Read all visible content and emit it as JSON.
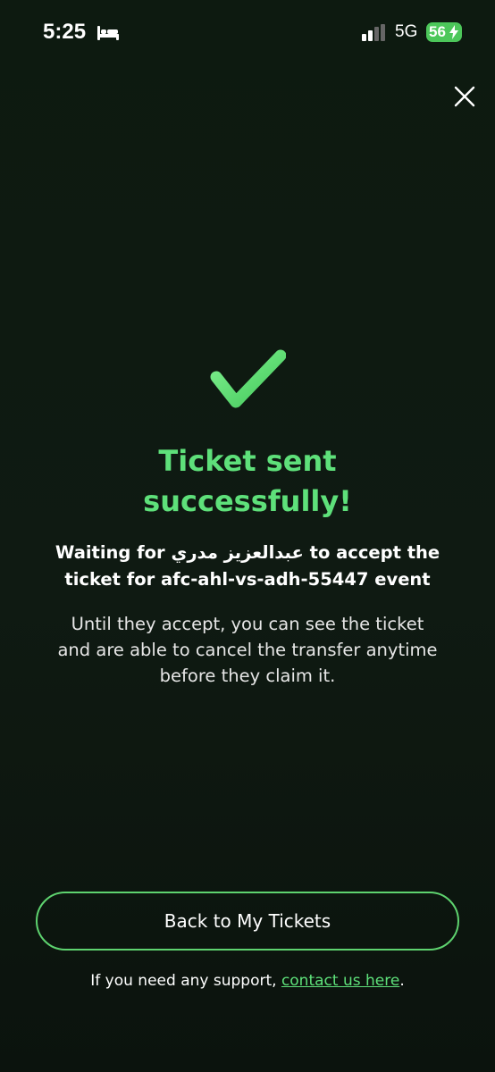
{
  "status_bar": {
    "time": "5:25",
    "network": "5G",
    "battery_level": "56",
    "icons": [
      "bed-icon",
      "signal-icon",
      "battery-icon",
      "bolt-icon"
    ]
  },
  "header": {
    "close_icon": "close-icon"
  },
  "main": {
    "icon": "checkmark-icon",
    "title_line1": "Ticket sent",
    "title_line2": "successfully!",
    "waiting_line1": "Waiting for عبدالعزيز مدري to accept the",
    "waiting_line2": "ticket for afc-ahl-vs-adh-55447 event",
    "info_line1": "Until they accept, you can see the ticket",
    "info_line2": "and are able to cancel the transfer anytime",
    "info_line3": "before they claim it."
  },
  "footer": {
    "back_button_label": "Back to My Tickets",
    "support_prefix": "If you need any support, ",
    "support_link": "contact us here",
    "support_suffix": "."
  },
  "colors": {
    "background": "#0f1a12",
    "accent": "#5ee07a",
    "button_border": "#5ed36f",
    "battery": "#4cc75a"
  }
}
